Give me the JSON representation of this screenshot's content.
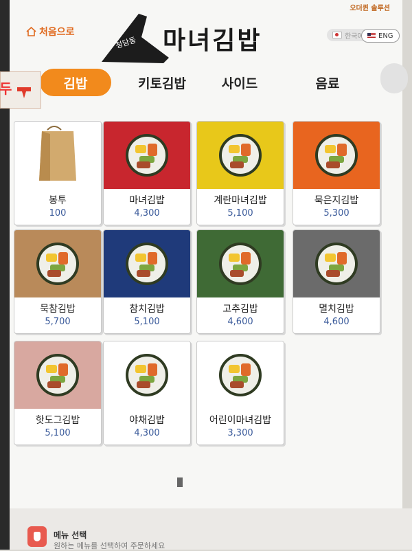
{
  "header": {
    "corner_brand": "오더퀸 솔루션",
    "home_label": "처음으로",
    "logo_sub": "청담동",
    "logo_main": "마녀김밥"
  },
  "languages": [
    {
      "label": "한국어",
      "flag": "kr-flag-icon"
    },
    {
      "label": "ENG",
      "flag": "us-flag-icon"
    }
  ],
  "side_tag": {
    "text": "두"
  },
  "tabs": [
    {
      "label": "김밥",
      "active": true
    },
    {
      "label": "키토김밥",
      "active": false
    },
    {
      "label": "사이드",
      "active": false
    },
    {
      "label": "음료",
      "active": false
    }
  ],
  "menu": [
    {
      "name": "봉투",
      "price": "100",
      "bg": "#ffffff"
    },
    {
      "name": "마녀김밥",
      "price": "4,300",
      "bg": "#c8262e"
    },
    {
      "name": "계란마녀김밥",
      "price": "5,100",
      "bg": "#e8c81a"
    },
    {
      "name": "묵은지김밥",
      "price": "5,300",
      "bg": "#e8651f"
    },
    {
      "name": "묵참김밥",
      "price": "5,700",
      "bg": "#b98a5a"
    },
    {
      "name": "참치김밥",
      "price": "5,100",
      "bg": "#1f3a7a"
    },
    {
      "name": "고추김밥",
      "price": "4,600",
      "bg": "#3f6a35"
    },
    {
      "name": "멸치김밥",
      "price": "4,600",
      "bg": "#6b6b6b"
    },
    {
      "name": "핫도그김밥",
      "price": "5,100",
      "bg": "#d8a8a0"
    },
    {
      "name": "야채김밥",
      "price": "4,300",
      "bg": "#ffffff"
    },
    {
      "name": "어린이마녀김밥",
      "price": "3,300",
      "bg": "#ffffff"
    }
  ],
  "footer": {
    "title": "메뉴 선택",
    "desc": "원하는 메뉴를 선택하여 주문하세요"
  }
}
